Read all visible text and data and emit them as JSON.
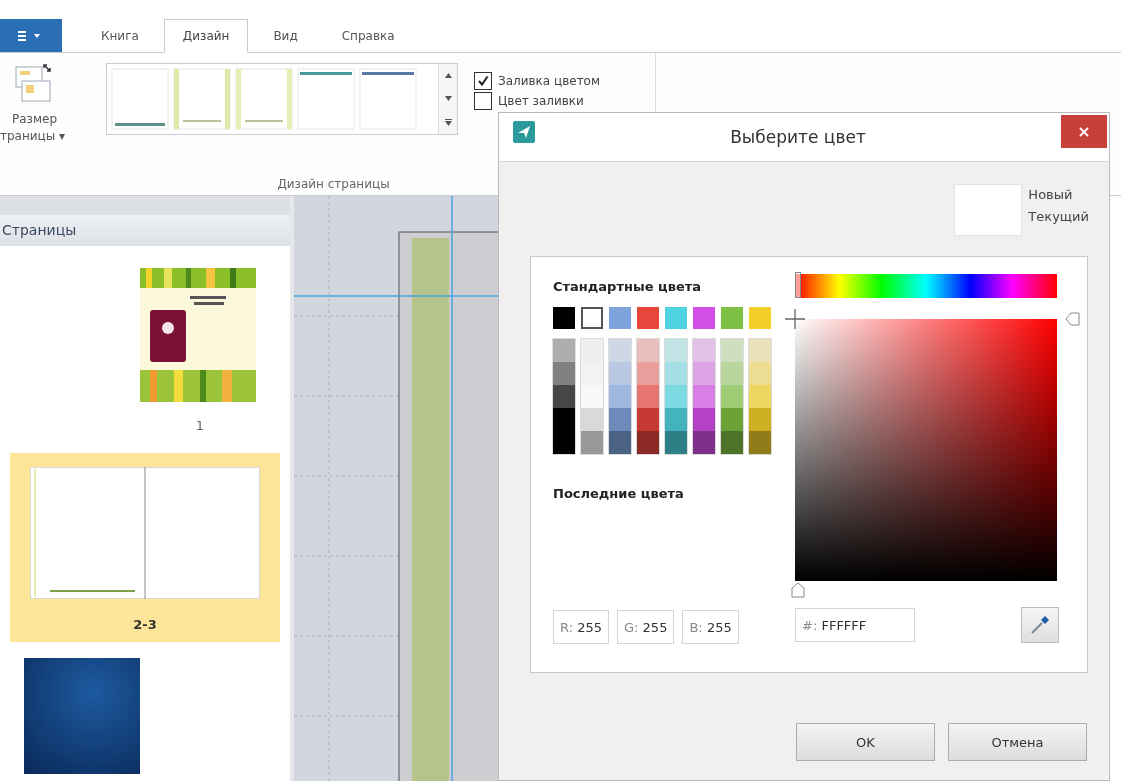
{
  "tabs": [
    {
      "label": "Книга",
      "selected": false
    },
    {
      "label": "Дизайн",
      "selected": true
    },
    {
      "label": "Вид",
      "selected": false
    },
    {
      "label": "Справка",
      "selected": false
    }
  ],
  "ribbon": {
    "page_size_button": {
      "lines": [
        "Размер",
        "траницы ▾"
      ]
    },
    "gallery": [
      {
        "kind": "bottom-line",
        "color": "#5e8f88"
      },
      {
        "kind": "side-frame",
        "color": "#dfe9a8"
      },
      {
        "kind": "side-frame",
        "color": "#e6eeb4"
      },
      {
        "kind": "top-line",
        "color": "#4a9c9a"
      },
      {
        "kind": "top-line",
        "color": "#5a78a8"
      }
    ],
    "checkboxes": [
      {
        "label": "Заливка цветом",
        "checked": true
      },
      {
        "label": "Цвет заливки",
        "checked": false
      }
    ],
    "group_label": "Дизайн страницы"
  },
  "pages_panel": {
    "title": "Страницы",
    "items": [
      {
        "kind": "cover",
        "label": "1",
        "selected": false
      },
      {
        "kind": "spread",
        "label": "2-3",
        "selected": true
      },
      {
        "kind": "dark",
        "selected": false
      }
    ]
  },
  "dialog": {
    "title": "Выберите цвет",
    "new_label": "Новый",
    "current_label": "Текущий",
    "standard_title": "Стандартные цвета",
    "standard_colors": [
      {
        "color": "#000000",
        "selected": false
      },
      {
        "color": "#ffffff",
        "selected": true
      },
      {
        "color": "#7fa3dc",
        "selected": false
      },
      {
        "color": "#e8453c",
        "selected": false
      },
      {
        "color": "#4fd3e0",
        "selected": false
      },
      {
        "color": "#d24fe6",
        "selected": false
      },
      {
        "color": "#7ec043",
        "selected": false
      },
      {
        "color": "#f2cf2a",
        "selected": false
      }
    ],
    "recent_title": "Последние цвета",
    "hue_slider": {
      "level": 0
    },
    "brightness_slider": {
      "level": 1
    },
    "saturation_slider": {
      "level": 0
    },
    "fields": [
      {
        "label": "R:",
        "value": "255"
      },
      {
        "label": "G:",
        "value": "255"
      },
      {
        "label": "B:",
        "value": "255"
      }
    ],
    "hex": {
      "label": "#:",
      "value": "FFFFFF"
    },
    "buttons": [
      "OK",
      "Отмена"
    ]
  }
}
